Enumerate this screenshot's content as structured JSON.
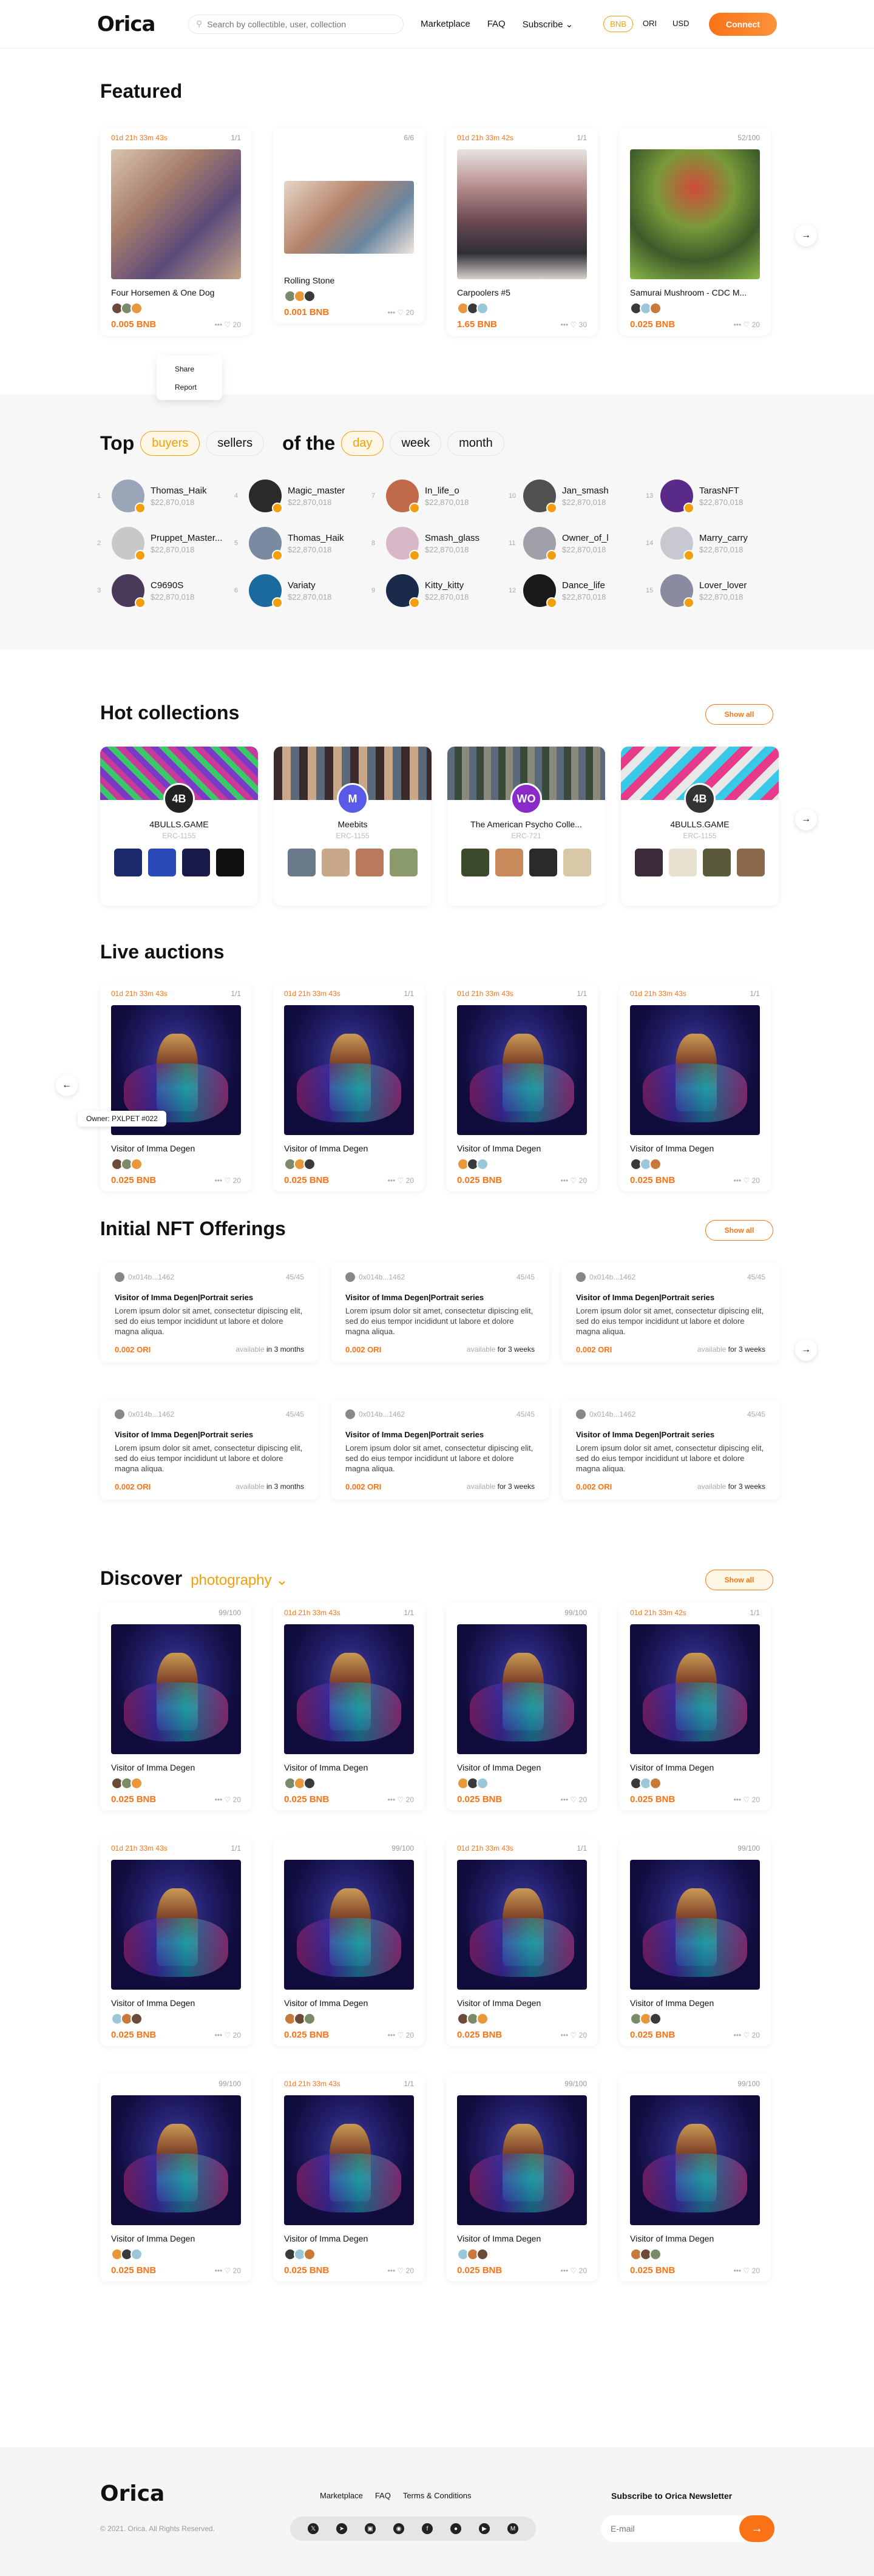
{
  "header": {
    "logo": "Orica",
    "search_placeholder": "Search by collectible, user, collection",
    "nav": [
      "Marketplace",
      "FAQ",
      "Subscribe"
    ],
    "currencies": [
      "BNB",
      "ORI",
      "USD"
    ],
    "connect": "Connect"
  },
  "featured": {
    "title": "Featured",
    "cards": [
      {
        "timer": "01d 21h 33m 43s",
        "count": "1/1",
        "title": "Four Horsemen & One Dog",
        "price": "0.005 BNB",
        "likes": "20"
      },
      {
        "timer": "",
        "count": "6/6",
        "title": "Rolling Stone",
        "price": "0.001 BNB",
        "likes": "20"
      },
      {
        "timer": "01d 21h 33m 42s",
        "count": "1/1",
        "title": "Carpoolers #5",
        "price": "1.65 BNB",
        "likes": "30"
      },
      {
        "timer": "",
        "count": "52/100",
        "title": "Samurai Mushroom - CDC M...",
        "price": "0.025 BNB",
        "likes": "20"
      }
    ],
    "menu": [
      "Share",
      "Report"
    ]
  },
  "top": {
    "title1": "Top",
    "tabs1": [
      "buyers",
      "sellers"
    ],
    "title2": "of the",
    "tabs2": [
      "day",
      "week",
      "month"
    ],
    "sellers": [
      {
        "n": "1",
        "name": "Thomas_Haik",
        "value": "$22,870,018"
      },
      {
        "n": "2",
        "name": "Pruppet_Master...",
        "value": "$22,870,018"
      },
      {
        "n": "3",
        "name": "C9690S",
        "value": "$22,870,018"
      },
      {
        "n": "4",
        "name": "Magic_master",
        "value": "$22,870,018"
      },
      {
        "n": "5",
        "name": "Thomas_Haik",
        "value": "$22,870,018"
      },
      {
        "n": "6",
        "name": "Variaty",
        "value": "$22,870,018"
      },
      {
        "n": "7",
        "name": "In_life_o",
        "value": "$22,870,018"
      },
      {
        "n": "8",
        "name": "Smash_glass",
        "value": "$22,870,018"
      },
      {
        "n": "9",
        "name": "Kitty_kitty",
        "value": "$22,870,018"
      },
      {
        "n": "10",
        "name": "Jan_smash",
        "value": "$22,870,018"
      },
      {
        "n": "11",
        "name": "Owner_of_l",
        "value": "$22,870,018"
      },
      {
        "n": "12",
        "name": "Dance_life",
        "value": "$22,870,018"
      },
      {
        "n": "13",
        "name": "TarasNFT",
        "value": "$22,870,018"
      },
      {
        "n": "14",
        "name": "Marry_carry",
        "value": "$22,870,018"
      },
      {
        "n": "15",
        "name": "Lover_lover",
        "value": "$22,870,018"
      }
    ]
  },
  "hot": {
    "title": "Hot collections",
    "show_all": "Show all",
    "items": [
      {
        "name": "4BULLS.GAME",
        "type": "ERC-1155",
        "logo": "4B"
      },
      {
        "name": "Meebits",
        "type": "ERC-1155",
        "logo": "M"
      },
      {
        "name": "The American Psycho Colle...",
        "type": "ERC-721",
        "logo": "WO"
      },
      {
        "name": "4BULLS.GAME",
        "type": "ERC-1155",
        "logo": "4B"
      }
    ]
  },
  "live": {
    "title": "Live auctions",
    "tooltip": "Owner: PXLPET #022",
    "cards": [
      {
        "timer": "01d 21h 33m 43s",
        "count": "1/1",
        "title": "Visitor of Imma Degen",
        "price": "0.025 BNB",
        "likes": "20"
      },
      {
        "timer": "01d 21h 33m 43s",
        "count": "1/1",
        "title": "Visitor of Imma Degen",
        "price": "0.025 BNB",
        "likes": "20"
      },
      {
        "timer": "01d 21h 33m 43s",
        "count": "1/1",
        "title": "Visitor of Imma Degen",
        "price": "0.025 BNB",
        "likes": "20"
      },
      {
        "timer": "01d 21h 33m 43s",
        "count": "1/1",
        "title": "Visitor of Imma Degen",
        "price": "0.025 BNB",
        "likes": "20"
      }
    ]
  },
  "ino": {
    "title": "Initial NFT Offerings",
    "show_all": "Show all",
    "items": [
      {
        "addr": "0x014b...1462",
        "count": "45/45",
        "title": "Visitor of Imma Degen|Portrait series",
        "desc": "Lorem ipsum dolor sit amet, consectetur dipiscing elit, sed do eius tempor incididunt ut labore et dolore magna aliqua.",
        "price": "0.002 ORI",
        "avail": "available",
        "period": "in 3 months"
      },
      {
        "addr": "0x014b...1462",
        "count": "45/45",
        "title": "Visitor of Imma Degen|Portrait series",
        "desc": "Lorem ipsum dolor sit amet, consectetur dipiscing elit, sed do eius tempor incididunt ut labore et dolore magna aliqua.",
        "price": "0.002 ORI",
        "avail": "available",
        "period": "for 3 weeks"
      },
      {
        "addr": "0x014b...1462",
        "count": "45/45",
        "title": "Visitor of Imma Degen|Portrait series",
        "desc": "Lorem ipsum dolor sit amet, consectetur dipiscing elit, sed do eius tempor incididunt ut labore et dolore magna aliqua.",
        "price": "0.002 ORI",
        "avail": "available",
        "period": "for 3 weeks"
      },
      {
        "addr": "0x014b...1462",
        "count": "45/45",
        "title": "Visitor of Imma Degen|Portrait series",
        "desc": "Lorem ipsum dolor sit amet, consectetur dipiscing elit, sed do eius tempor incididunt ut labore et dolore magna aliqua.",
        "price": "0.002 ORI",
        "avail": "available",
        "period": "in 3 months"
      },
      {
        "addr": "0x014b...1462",
        "count": "45/45",
        "title": "Visitor of Imma Degen|Portrait series",
        "desc": "Lorem ipsum dolor sit amet, consectetur dipiscing elit, sed do eius tempor incididunt ut labore et dolore magna aliqua.",
        "price": "0.002 ORI",
        "avail": "available",
        "period": "for 3 weeks"
      },
      {
        "addr": "0x014b...1462",
        "count": "45/45",
        "title": "Visitor of Imma Degen|Portrait series",
        "desc": "Lorem ipsum dolor sit amet, consectetur dipiscing elit, sed do eius tempor incididunt ut labore et dolore magna aliqua.",
        "price": "0.002 ORI",
        "avail": "available",
        "period": "for 3 weeks"
      }
    ]
  },
  "discover": {
    "title": "Discover",
    "category": "photography",
    "show_all": "Show all",
    "cards": [
      {
        "timer": "",
        "count": "99/100",
        "title": "Visitor of Imma Degen",
        "price": "0.025 BNB",
        "likes": "20"
      },
      {
        "timer": "01d 21h 33m 43s",
        "count": "1/1",
        "title": "Visitor of Imma Degen",
        "price": "0.025 BNB",
        "likes": "20"
      },
      {
        "timer": "",
        "count": "99/100",
        "title": "Visitor of Imma Degen",
        "price": "0.025 BNB",
        "likes": "20"
      },
      {
        "timer": "01d 21h 33m 42s",
        "count": "1/1",
        "title": "Visitor of Imma Degen",
        "price": "0.025 BNB",
        "likes": "20"
      },
      {
        "timer": "01d 21h 33m 43s",
        "count": "1/1",
        "title": "Visitor of Imma Degen",
        "price": "0.025 BNB",
        "likes": "20"
      },
      {
        "timer": "",
        "count": "99/100",
        "title": "Visitor of Imma Degen",
        "price": "0.025 BNB",
        "likes": "20"
      },
      {
        "timer": "01d 21h 33m 43s",
        "count": "1/1",
        "title": "Visitor of Imma Degen",
        "price": "0.025 BNB",
        "likes": "20"
      },
      {
        "timer": "",
        "count": "99/100",
        "title": "Visitor of Imma Degen",
        "price": "0.025 BNB",
        "likes": "20"
      },
      {
        "timer": "",
        "count": "99/100",
        "title": "Visitor of Imma Degen",
        "price": "0.025 BNB",
        "likes": "20"
      },
      {
        "timer": "01d 21h 33m 43s",
        "count": "1/1",
        "title": "Visitor of Imma Degen",
        "price": "0.025 BNB",
        "likes": "20"
      },
      {
        "timer": "",
        "count": "99/100",
        "title": "Visitor of Imma Degen",
        "price": "0.025 BNB",
        "likes": "20"
      },
      {
        "timer": "",
        "count": "99/100",
        "title": "Visitor of Imma Degen",
        "price": "0.025 BNB",
        "likes": "20"
      }
    ]
  },
  "footer": {
    "logo": "Orica",
    "copyright": "© 2021. Orica. All Rights Reserved.",
    "links": [
      "Marketplace",
      "FAQ",
      "Terms & Conditions"
    ],
    "newsletter": "Subscribe to Orica Newsletter",
    "email_placeholder": "E-mail",
    "socials": [
      "twitter-icon",
      "telegram-icon",
      "instagram-icon",
      "discord-icon",
      "facebook-icon",
      "reddit-icon",
      "youtube-icon",
      "medium-icon"
    ]
  },
  "colors": {
    "accent": "#f97316",
    "gold": "#f59e0b"
  }
}
